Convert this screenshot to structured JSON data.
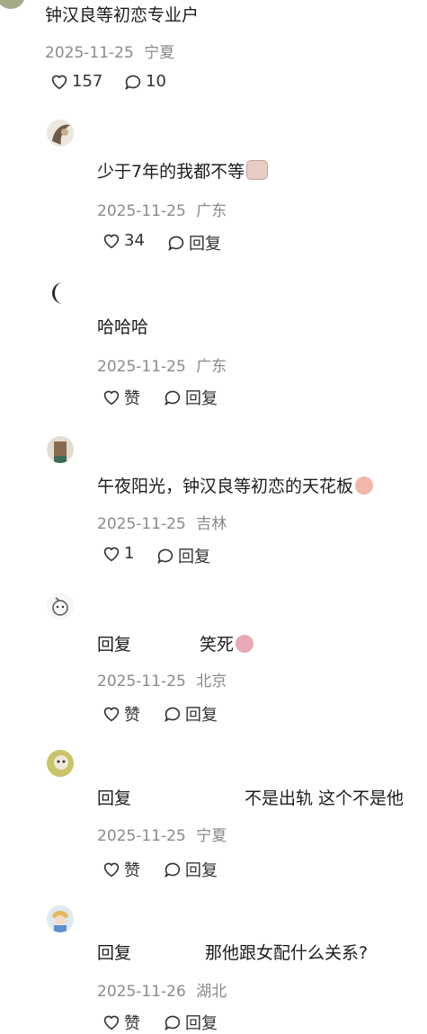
{
  "comments": [
    {
      "text": "钟汉良等初恋专业户",
      "date": "2025-11-25",
      "location": "宁夏",
      "likes": "157",
      "replies": "10"
    },
    {
      "text": "少于7年的我都不等",
      "date": "2025-11-25",
      "location": "广东",
      "likes": "34",
      "reply_label": "回复",
      "emoji_icon": "cat-sunglasses-sticker"
    },
    {
      "text": "哈哈哈",
      "date": "2025-11-25",
      "location": "广东",
      "likes": "赞",
      "reply_label": "回复"
    },
    {
      "text": "午夜阳光，钟汉良等初恋的天花板",
      "date": "2025-11-25",
      "location": "吉林",
      "likes": "1",
      "reply_label": "回复",
      "emoji_icon": "laughing-face-sticker"
    },
    {
      "prefix": "回复",
      "text": "笑死",
      "date": "2025-11-25",
      "location": "北京",
      "likes": "赞",
      "reply_label": "回复",
      "emoji_icon": "crying-face-sticker"
    },
    {
      "prefix": "回复",
      "text": "不是出轨 这个不是他",
      "date": "2025-11-25",
      "location": "宁夏",
      "likes": "赞",
      "reply_label": "回复"
    },
    {
      "prefix": "回复",
      "text": "那他跟女配什么关系?",
      "date": "2025-11-26",
      "location": "湖北",
      "likes": "赞",
      "reply_label": "回复"
    }
  ]
}
